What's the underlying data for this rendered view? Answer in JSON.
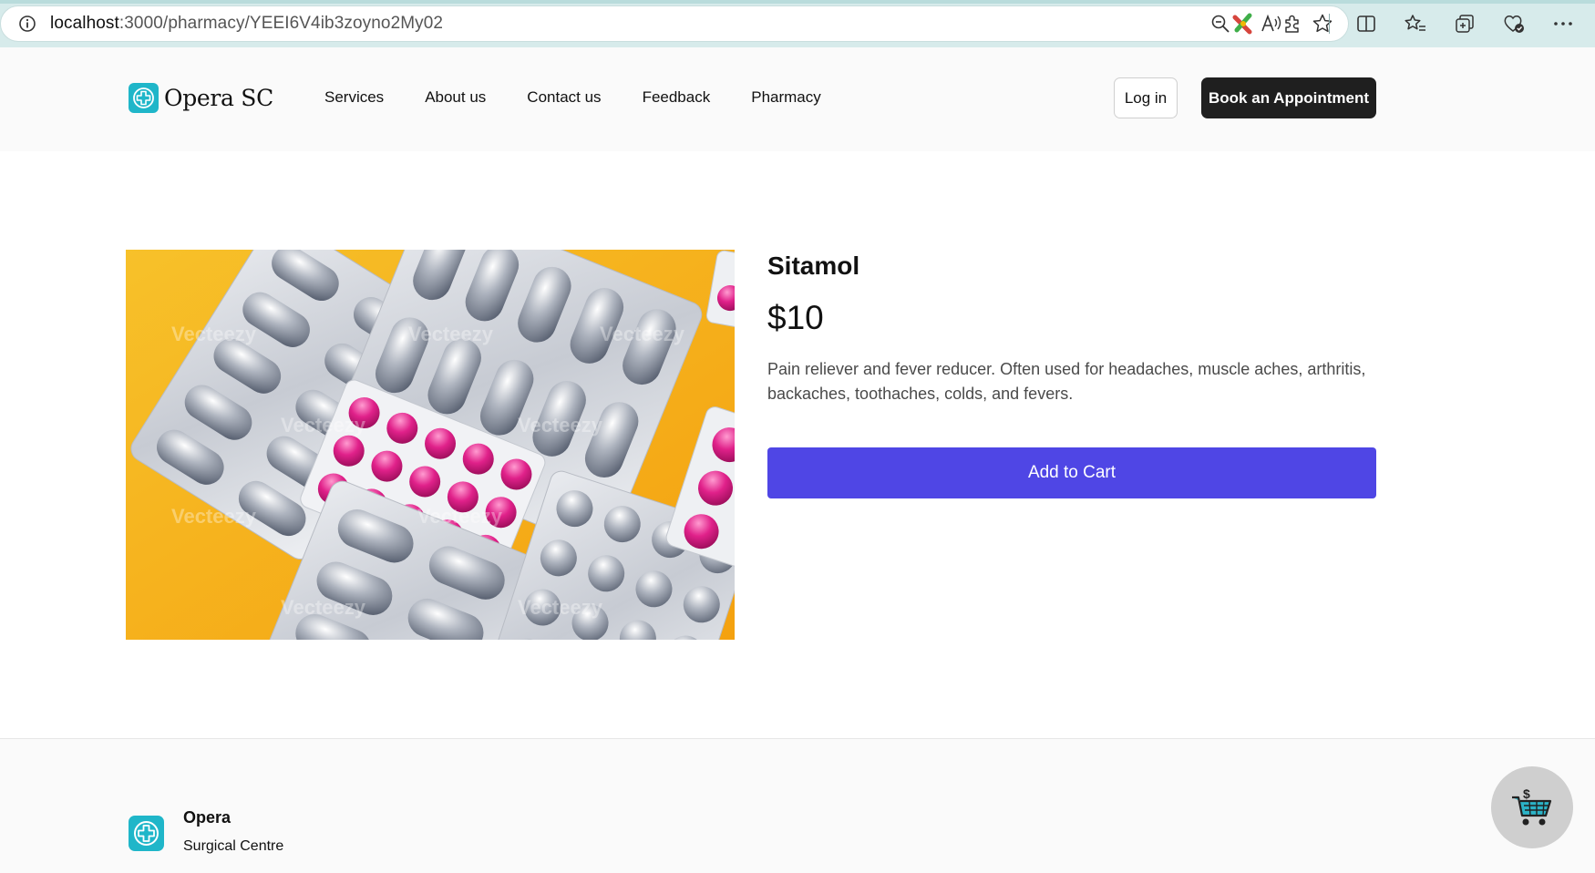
{
  "browser": {
    "url_host": "localhost",
    "url_path": ":3000/pharmacy/YEEI6V4ib3zoyno2My02"
  },
  "header": {
    "logo_text": "Opera SC",
    "nav": [
      "Services",
      "About us",
      "Contact us",
      "Feedback",
      "Pharmacy"
    ],
    "login_label": "Log in",
    "book_label": "Book an Appointment"
  },
  "product": {
    "name": "Sitamol",
    "price": "$10",
    "description": "Pain reliever and fever reducer. Often used for headaches, muscle aches, arthritis, backaches, toothaches, colds, and fevers.",
    "add_to_cart_label": "Add to Cart",
    "watermark": "Vecteezy"
  },
  "footer": {
    "title": "Opera",
    "subtitle": "Surgical Centre"
  },
  "colors": {
    "brand_teal": "#1fb6c9",
    "primary_button": "#4f46e5",
    "dark_button": "#1f1f1f",
    "image_background": "#f6b11d",
    "pill_pink": "#e0218a"
  },
  "icons": {
    "address_bar": [
      "info-icon",
      "zoom-icon",
      "read-aloud-icon",
      "favorite-star-icon"
    ],
    "toolbar": [
      "extension-colorful-icon",
      "extensions-puzzle-icon",
      "split-screen-icon",
      "favorites-icon",
      "collections-icon",
      "browser-essentials-icon",
      "more-menu-icon"
    ],
    "fab": "shopping-cart-icon"
  }
}
